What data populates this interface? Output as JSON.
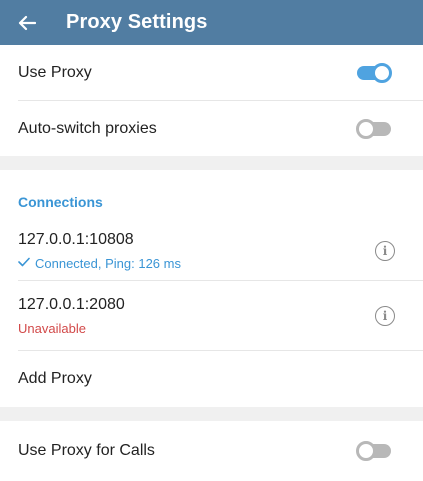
{
  "header": {
    "title": "Proxy Settings"
  },
  "settings": [
    {
      "label": "Use Proxy",
      "toggle": "on"
    },
    {
      "label": "Auto-switch proxies",
      "toggle": "off"
    }
  ],
  "connections": {
    "title": "Connections",
    "items": [
      {
        "address": "127.0.0.1:10808",
        "status": "Connected, Ping: 126 ms",
        "status_type": "connected"
      },
      {
        "address": "127.0.0.1:2080",
        "status": "Unavailable",
        "status_type": "unavailable"
      }
    ],
    "add_label": "Add Proxy"
  },
  "calls": {
    "label": "Use Proxy for Calls",
    "toggle": "off"
  },
  "colors": {
    "header_bg": "#517da2",
    "accent": "#3a95d5",
    "toggle_on": "#4fa3e0",
    "error": "#d24949"
  },
  "icons": {
    "back": "arrow-left-icon",
    "info": "info-circle-icon",
    "check": "check-icon"
  }
}
